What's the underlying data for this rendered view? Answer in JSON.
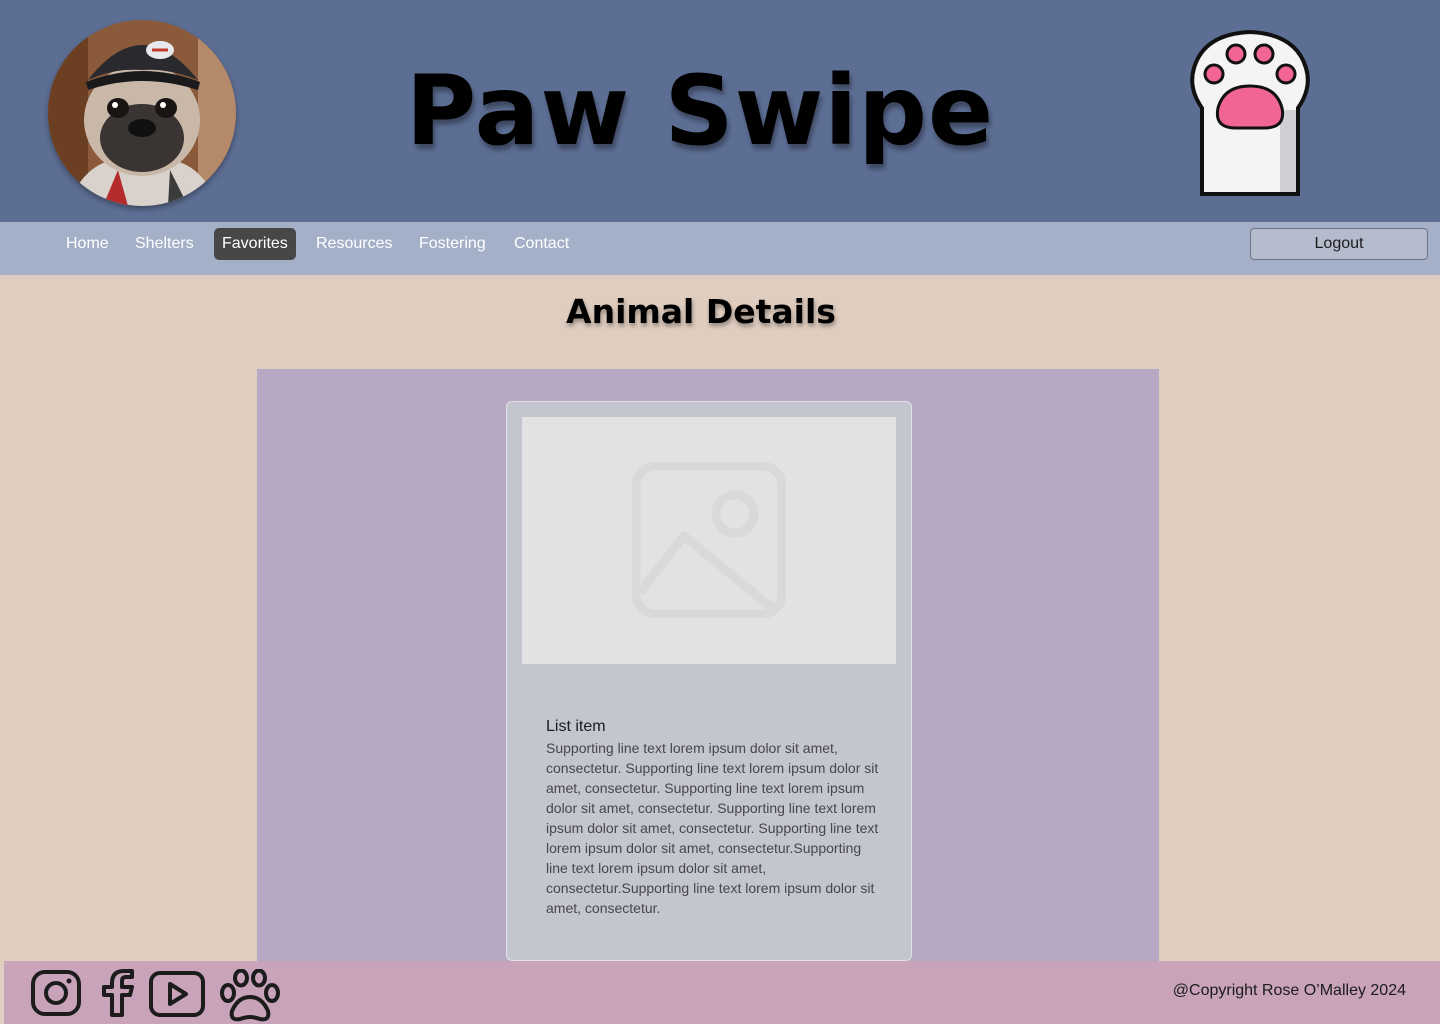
{
  "header": {
    "title": "Paw Swipe",
    "avatar_icon": "pug-photo",
    "logo_icon": "paw-logo-icon"
  },
  "nav": {
    "items": [
      {
        "label": "Home",
        "active": false
      },
      {
        "label": "Shelters",
        "active": false
      },
      {
        "label": "Favorites",
        "active": true
      },
      {
        "label": "Resources",
        "active": false
      },
      {
        "label": "Fostering",
        "active": false
      },
      {
        "label": "Contact",
        "active": false
      }
    ],
    "logout_label": "Logout"
  },
  "main": {
    "title": "Animal Details",
    "card": {
      "image_icon": "image-placeholder-icon",
      "heading": "List item",
      "body": "Supporting line text lorem ipsum dolor sit amet, consectetur. Supporting line text lorem ipsum dolor sit amet, consectetur. Supporting line text lorem ipsum dolor sit amet, consectetur. Supporting line text lorem ipsum dolor sit amet, consectetur. Supporting line text lorem ipsum dolor sit amet, consectetur.Supporting line text lorem ipsum dolor sit amet, consectetur.Supporting line text lorem ipsum dolor sit amet, consectetur."
    }
  },
  "footer": {
    "social_icons": [
      "instagram-icon",
      "facebook-icon",
      "youtube-icon",
      "paw-icon"
    ],
    "copyright": "@Copyright Rose O’Malley 2024"
  },
  "colors": {
    "header_bg": "#5d6e94",
    "nav_bg": "#a3b0c8",
    "nav_active": "#474747",
    "page_bg": "#dfcdbf",
    "panel_bg": "#b8a9c2",
    "card_bg": "#c3c6ce",
    "footer_bg": "#c8a3b9",
    "paw_pink": "#f06595"
  }
}
